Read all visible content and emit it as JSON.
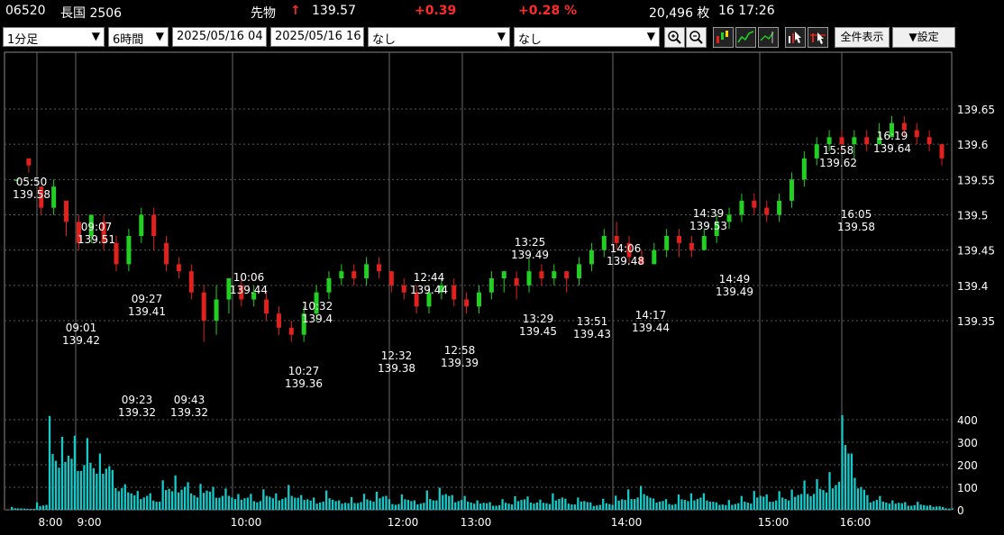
{
  "header": {
    "code": "06520",
    "name": "長国 2506",
    "type": "先物",
    "arrow": "↑",
    "price": "139.57",
    "change": "+0.39",
    "change_pct": "+0.28 %",
    "volume": "20,496 枚",
    "time": "16 17:26"
  },
  "toolbar": {
    "interval": "1分足",
    "span": "6時間",
    "from_date": "2025/05/16 04",
    "to_date": "2025/05/16 16",
    "indicator1": "なし",
    "indicator2": "なし",
    "zoom_in_icon": "magnifier-plus-icon",
    "zoom_out_icon": "magnifier-minus-icon",
    "show_all_label": "全件表示",
    "settings_label": "▼設定"
  },
  "colors": {
    "up": "#21d021",
    "down": "#e0211d",
    "volume": "#17c9c9",
    "grid": "#5a5a5a",
    "accent_red": "#ff2a2a"
  },
  "chart_data": {
    "type": "candlestick",
    "price_axis": {
      "ticks": [
        "139.65",
        "139.6",
        "139.55",
        "139.5",
        "139.45",
        "139.4",
        "139.35"
      ]
    },
    "volume_axis": {
      "ticks": [
        "400",
        "300",
        "200",
        "100",
        "0"
      ]
    },
    "time_axis": {
      "ticks": [
        "8:00",
        "9:00",
        "10:00",
        "12:00",
        "13:00",
        "14:00",
        "15:00",
        "16:00"
      ]
    },
    "annotations": [
      {
        "time": "05:50",
        "value": "139.58"
      },
      {
        "time": "09:07",
        "value": "139.51"
      },
      {
        "time": "09:01",
        "value": "139.42"
      },
      {
        "time": "09:27",
        "value": "139.41"
      },
      {
        "time": "09:23",
        "value": "139.32"
      },
      {
        "time": "09:43",
        "value": "139.32"
      },
      {
        "time": "10:06",
        "value": "139.44"
      },
      {
        "time": "10:32",
        "value": "139.4"
      },
      {
        "time": "10:27",
        "value": "139.36"
      },
      {
        "time": "12:32",
        "value": "139.38"
      },
      {
        "time": "12:44",
        "value": "139.44"
      },
      {
        "time": "12:58",
        "value": "139.39"
      },
      {
        "time": "13:25",
        "value": "139.49"
      },
      {
        "time": "13:29",
        "value": "139.45"
      },
      {
        "time": "13:51",
        "value": "139.43"
      },
      {
        "time": "14:06",
        "value": "139.48"
      },
      {
        "time": "14:17",
        "value": "139.44"
      },
      {
        "time": "14:39",
        "value": "139.53"
      },
      {
        "time": "14:49",
        "value": "139.49"
      },
      {
        "time": "15:58",
        "value": "139.62"
      },
      {
        "time": "16:05",
        "value": "139.58"
      },
      {
        "time": "16:19",
        "value": "139.64"
      }
    ],
    "candles": [
      {
        "o": 139.55,
        "c": 139.55,
        "h": 139.55,
        "l": 139.55
      },
      {
        "o": 139.58,
        "c": 139.57,
        "h": 139.58,
        "l": 139.56
      },
      {
        "o": 139.54,
        "c": 139.51,
        "h": 139.54,
        "l": 139.5
      },
      {
        "o": 139.51,
        "c": 139.54,
        "h": 139.55,
        "l": 139.5
      },
      {
        "o": 139.52,
        "c": 139.49,
        "h": 139.52,
        "l": 139.47
      },
      {
        "o": 139.49,
        "c": 139.46,
        "h": 139.5,
        "l": 139.45
      },
      {
        "o": 139.47,
        "c": 139.5,
        "h": 139.5,
        "l": 139.46
      },
      {
        "o": 139.49,
        "c": 139.46,
        "h": 139.5,
        "l": 139.45
      },
      {
        "o": 139.46,
        "c": 139.43,
        "h": 139.47,
        "l": 139.42
      },
      {
        "o": 139.43,
        "c": 139.47,
        "h": 139.48,
        "l": 139.42
      },
      {
        "o": 139.47,
        "c": 139.5,
        "h": 139.51,
        "l": 139.46
      },
      {
        "o": 139.5,
        "c": 139.47,
        "h": 139.51,
        "l": 139.45
      },
      {
        "o": 139.46,
        "c": 139.43,
        "h": 139.47,
        "l": 139.42
      },
      {
        "o": 139.43,
        "c": 139.42,
        "h": 139.44,
        "l": 139.41
      },
      {
        "o": 139.42,
        "c": 139.39,
        "h": 139.43,
        "l": 139.38
      },
      {
        "o": 139.39,
        "c": 139.35,
        "h": 139.4,
        "l": 139.32
      },
      {
        "o": 139.35,
        "c": 139.38,
        "h": 139.4,
        "l": 139.33
      },
      {
        "o": 139.38,
        "c": 139.41,
        "h": 139.41,
        "l": 139.36
      },
      {
        "o": 139.4,
        "c": 139.38,
        "h": 139.41,
        "l": 139.37
      },
      {
        "o": 139.38,
        "c": 139.39,
        "h": 139.4,
        "l": 139.37
      },
      {
        "o": 139.38,
        "c": 139.36,
        "h": 139.39,
        "l": 139.35
      },
      {
        "o": 139.36,
        "c": 139.34,
        "h": 139.37,
        "l": 139.33
      },
      {
        "o": 139.34,
        "c": 139.33,
        "h": 139.35,
        "l": 139.32
      },
      {
        "o": 139.33,
        "c": 139.36,
        "h": 139.37,
        "l": 139.32
      },
      {
        "o": 139.36,
        "c": 139.39,
        "h": 139.4,
        "l": 139.35
      },
      {
        "o": 139.39,
        "c": 139.41,
        "h": 139.42,
        "l": 139.38
      },
      {
        "o": 139.41,
        "c": 139.42,
        "h": 139.43,
        "l": 139.4
      },
      {
        "o": 139.42,
        "c": 139.41,
        "h": 139.43,
        "l": 139.4
      },
      {
        "o": 139.41,
        "c": 139.43,
        "h": 139.44,
        "l": 139.4
      },
      {
        "o": 139.43,
        "c": 139.42,
        "h": 139.44,
        "l": 139.41
      },
      {
        "o": 139.42,
        "c": 139.4,
        "h": 139.42,
        "l": 139.39
      },
      {
        "o": 139.4,
        "c": 139.39,
        "h": 139.41,
        "l": 139.38
      },
      {
        "o": 139.39,
        "c": 139.37,
        "h": 139.4,
        "l": 139.36
      },
      {
        "o": 139.37,
        "c": 139.39,
        "h": 139.4,
        "l": 139.36
      },
      {
        "o": 139.39,
        "c": 139.4,
        "h": 139.41,
        "l": 139.38
      },
      {
        "o": 139.4,
        "c": 139.38,
        "h": 139.41,
        "l": 139.37
      },
      {
        "o": 139.38,
        "c": 139.37,
        "h": 139.39,
        "l": 139.36
      },
      {
        "o": 139.37,
        "c": 139.39,
        "h": 139.4,
        "l": 139.36
      },
      {
        "o": 139.39,
        "c": 139.41,
        "h": 139.42,
        "l": 139.38
      },
      {
        "o": 139.41,
        "c": 139.42,
        "h": 139.42,
        "l": 139.39
      },
      {
        "o": 139.41,
        "c": 139.4,
        "h": 139.42,
        "l": 139.38
      },
      {
        "o": 139.4,
        "c": 139.42,
        "h": 139.44,
        "l": 139.39
      },
      {
        "o": 139.42,
        "c": 139.41,
        "h": 139.43,
        "l": 139.4
      },
      {
        "o": 139.41,
        "c": 139.42,
        "h": 139.43,
        "l": 139.4
      },
      {
        "o": 139.42,
        "c": 139.41,
        "h": 139.42,
        "l": 139.39
      },
      {
        "o": 139.41,
        "c": 139.43,
        "h": 139.44,
        "l": 139.4
      },
      {
        "o": 139.43,
        "c": 139.45,
        "h": 139.46,
        "l": 139.42
      },
      {
        "o": 139.45,
        "c": 139.47,
        "h": 139.48,
        "l": 139.44
      },
      {
        "o": 139.47,
        "c": 139.46,
        "h": 139.49,
        "l": 139.45
      },
      {
        "o": 139.46,
        "c": 139.44,
        "h": 139.47,
        "l": 139.43
      },
      {
        "o": 139.44,
        "c": 139.43,
        "h": 139.45,
        "l": 139.43
      },
      {
        "o": 139.43,
        "c": 139.45,
        "h": 139.46,
        "l": 139.43
      },
      {
        "o": 139.45,
        "c": 139.47,
        "h": 139.48,
        "l": 139.44
      },
      {
        "o": 139.47,
        "c": 139.46,
        "h": 139.48,
        "l": 139.44
      },
      {
        "o": 139.46,
        "c": 139.45,
        "h": 139.47,
        "l": 139.44
      },
      {
        "o": 139.45,
        "c": 139.47,
        "h": 139.48,
        "l": 139.45
      },
      {
        "o": 139.47,
        "c": 139.49,
        "h": 139.5,
        "l": 139.46
      },
      {
        "o": 139.49,
        "c": 139.5,
        "h": 139.51,
        "l": 139.48
      },
      {
        "o": 139.5,
        "c": 139.52,
        "h": 139.53,
        "l": 139.49
      },
      {
        "o": 139.52,
        "c": 139.51,
        "h": 139.53,
        "l": 139.5
      },
      {
        "o": 139.51,
        "c": 139.5,
        "h": 139.52,
        "l": 139.49
      },
      {
        "o": 139.5,
        "c": 139.52,
        "h": 139.53,
        "l": 139.49
      },
      {
        "o": 139.52,
        "c": 139.55,
        "h": 139.56,
        "l": 139.51
      },
      {
        "o": 139.55,
        "c": 139.58,
        "h": 139.59,
        "l": 139.54
      },
      {
        "o": 139.58,
        "c": 139.6,
        "h": 139.61,
        "l": 139.57
      },
      {
        "o": 139.6,
        "c": 139.61,
        "h": 139.62,
        "l": 139.59
      },
      {
        "o": 139.61,
        "c": 139.6,
        "h": 139.62,
        "l": 139.59
      },
      {
        "o": 139.6,
        "c": 139.61,
        "h": 139.62,
        "l": 139.58
      },
      {
        "o": 139.61,
        "c": 139.6,
        "h": 139.62,
        "l": 139.59
      },
      {
        "o": 139.6,
        "c": 139.61,
        "h": 139.63,
        "l": 139.6
      },
      {
        "o": 139.61,
        "c": 139.63,
        "h": 139.64,
        "l": 139.61
      },
      {
        "o": 139.63,
        "c": 139.62,
        "h": 139.64,
        "l": 139.61
      },
      {
        "o": 139.62,
        "c": 139.61,
        "h": 139.63,
        "l": 139.6
      },
      {
        "o": 139.61,
        "c": 139.6,
        "h": 139.62,
        "l": 139.59
      },
      {
        "o": 139.6,
        "c": 139.58,
        "h": 139.6,
        "l": 139.57
      }
    ],
    "volumes": [
      10,
      5,
      30,
      340,
      310,
      290,
      270,
      250,
      150,
      100,
      80,
      60,
      120,
      140,
      100,
      110,
      90,
      80,
      70,
      60,
      80,
      70,
      90,
      60,
      50,
      70,
      40,
      50,
      60,
      80,
      40,
      60,
      40,
      70,
      90,
      60,
      50,
      40,
      30,
      40,
      60,
      50,
      40,
      70,
      40,
      50,
      30,
      40,
      60,
      80,
      90,
      50,
      40,
      60,
      70,
      60,
      30,
      40,
      50,
      80,
      60,
      70,
      90,
      110,
      120,
      160,
      420,
      130,
      60,
      50,
      40,
      30,
      30,
      20,
      10
    ]
  }
}
